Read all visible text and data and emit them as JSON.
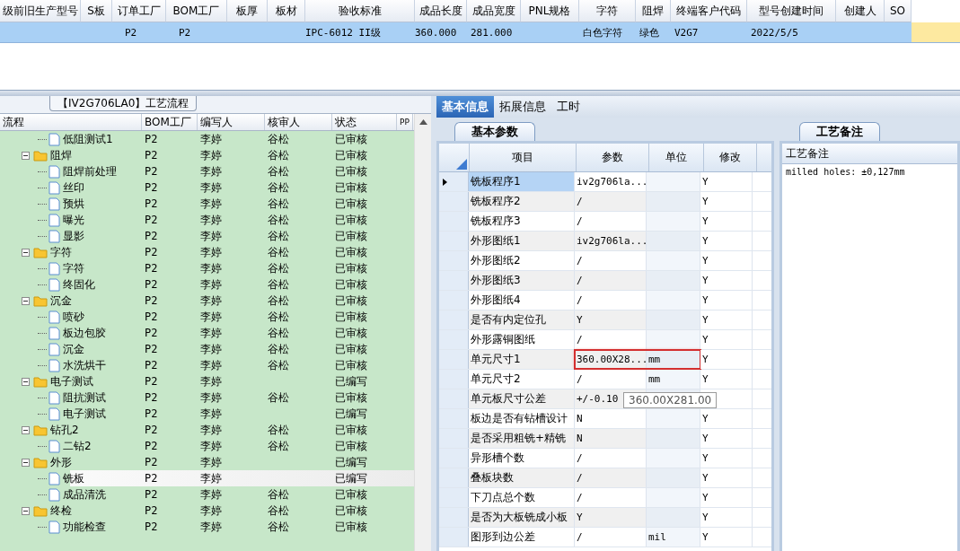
{
  "top_grid": {
    "columns": [
      "级前旧生产型号",
      "S板",
      "订单工厂",
      "BOM工厂",
      "板厚",
      "板材",
      "验收标准",
      "成品长度",
      "成品宽度",
      "PNL规格",
      "字符",
      "阻焊",
      "终端客户代码",
      "型号创建时间",
      "创建人",
      "SO"
    ],
    "rows": [
      {
        "selected": true,
        "cells": [
          null,
          null,
          "P2",
          "P2",
          null,
          null,
          "IPC-6012 II级",
          "360.000",
          "281.000",
          null,
          "白色字符",
          "绿色",
          "V2G7",
          "2022/5/5",
          null,
          null
        ]
      }
    ]
  },
  "process_panel": {
    "title": "【IV2G706LA0】工艺流程",
    "columns": [
      "流程",
      "BOM工厂",
      "编写人",
      "核审人",
      "状态",
      "PP"
    ],
    "leading_items": [
      {
        "label": "低阻测试1",
        "bom": "P2",
        "writer": "李婷",
        "reviewer": "谷松",
        "status": "已审核",
        "selected": false
      }
    ],
    "folders": [
      {
        "label": "阻焊",
        "expanded": true,
        "bom": "P2",
        "writer": "李婷",
        "reviewer": "谷松",
        "status": "已审核",
        "selected": false,
        "children": [
          {
            "label": "阻焊前处理",
            "bom": "P2",
            "writer": "李婷",
            "reviewer": "谷松",
            "status": "已审核",
            "selected": false
          },
          {
            "label": "丝印",
            "bom": "P2",
            "writer": "李婷",
            "reviewer": "谷松",
            "status": "已审核",
            "selected": false
          },
          {
            "label": "预烘",
            "bom": "P2",
            "writer": "李婷",
            "reviewer": "谷松",
            "status": "已审核",
            "selected": false
          },
          {
            "label": "曝光",
            "bom": "P2",
            "writer": "李婷",
            "reviewer": "谷松",
            "status": "已审核",
            "selected": false
          },
          {
            "label": "显影",
            "bom": "P2",
            "writer": "李婷",
            "reviewer": "谷松",
            "status": "已审核",
            "selected": false
          }
        ]
      },
      {
        "label": "字符",
        "expanded": true,
        "bom": "P2",
        "writer": "李婷",
        "reviewer": "谷松",
        "status": "已审核",
        "selected": false,
        "children": [
          {
            "label": "字符",
            "bom": "P2",
            "writer": "李婷",
            "reviewer": "谷松",
            "status": "已审核",
            "selected": false
          },
          {
            "label": "终固化",
            "bom": "P2",
            "writer": "李婷",
            "reviewer": "谷松",
            "status": "已审核",
            "selected": false
          }
        ]
      },
      {
        "label": "沉金",
        "expanded": true,
        "bom": "P2",
        "writer": "李婷",
        "reviewer": "谷松",
        "status": "已审核",
        "selected": false,
        "children": [
          {
            "label": "喷砂",
            "bom": "P2",
            "writer": "李婷",
            "reviewer": "谷松",
            "status": "已审核",
            "selected": false
          },
          {
            "label": "板边包胶",
            "bom": "P2",
            "writer": "李婷",
            "reviewer": "谷松",
            "status": "已审核",
            "selected": false
          },
          {
            "label": "沉金",
            "bom": "P2",
            "writer": "李婷",
            "reviewer": "谷松",
            "status": "已审核",
            "selected": false
          },
          {
            "label": "水洗烘干",
            "bom": "P2",
            "writer": "李婷",
            "reviewer": "谷松",
            "status": "已审核",
            "selected": false
          }
        ]
      },
      {
        "label": "电子测试",
        "expanded": true,
        "bom": "P2",
        "writer": "李婷",
        "status": "已编写",
        "selected": false,
        "children": [
          {
            "label": "阻抗测试",
            "bom": "P2",
            "writer": "李婷",
            "reviewer": "谷松",
            "status": "已审核",
            "selected": false
          },
          {
            "label": "电子测试",
            "bom": "P2",
            "writer": "李婷",
            "status": "已编写",
            "selected": false
          }
        ]
      },
      {
        "label": "钻孔2",
        "expanded": true,
        "bom": "P2",
        "writer": "李婷",
        "reviewer": "谷松",
        "status": "已审核",
        "selected": false,
        "children": [
          {
            "label": "二钻2",
            "bom": "P2",
            "writer": "李婷",
            "reviewer": "谷松",
            "status": "已审核",
            "selected": false
          }
        ]
      },
      {
        "label": "外形",
        "expanded": true,
        "bom": "P2",
        "writer": "李婷",
        "status": "已编写",
        "selected": false,
        "children": [
          {
            "label": "铣板",
            "bom": "P2",
            "writer": "李婷",
            "status": "已编写",
            "selected": true
          },
          {
            "label": "成品清洗",
            "bom": "P2",
            "writer": "李婷",
            "reviewer": "谷松",
            "status": "已审核",
            "selected": false
          }
        ]
      },
      {
        "label": "终检",
        "expanded": true,
        "bom": "P2",
        "writer": "李婷",
        "reviewer": "谷松",
        "status": "已审核",
        "selected": false,
        "children": [
          {
            "label": "功能检查",
            "bom": "P2",
            "writer": "李婷",
            "reviewer": "谷松",
            "status": "已审核",
            "selected": false
          }
        ]
      }
    ]
  },
  "info_tabs": [
    {
      "label": "基本信息",
      "selected": true
    },
    {
      "label": "拓展信息",
      "selected": false
    },
    {
      "label": "工时",
      "selected": false
    }
  ],
  "params_panel": {
    "tab": "基本参数",
    "columns": [
      "项目",
      "参数",
      "单位",
      "修改"
    ],
    "rows": [
      {
        "item": "铣板程序1",
        "value": "iv2g706la...",
        "modify": "Y",
        "current": true,
        "highlighted": false
      },
      {
        "item": "铣板程序2",
        "value": "/",
        "modify": "Y",
        "current": false,
        "highlighted": false
      },
      {
        "item": "铣板程序3",
        "value": "/",
        "modify": "Y",
        "current": false,
        "highlighted": false
      },
      {
        "item": "外形图纸1",
        "value": "iv2g706la...",
        "modify": "Y",
        "current": false,
        "highlighted": false
      },
      {
        "item": "外形图纸2",
        "value": "/",
        "modify": "Y",
        "current": false,
        "highlighted": false
      },
      {
        "item": "外形图纸3",
        "value": "/",
        "modify": "Y",
        "current": false,
        "highlighted": false
      },
      {
        "item": "外形图纸4",
        "value": "/",
        "modify": "Y",
        "current": false,
        "highlighted": false
      },
      {
        "item": "是否有内定位孔",
        "value": "Y",
        "modify": "Y",
        "current": false,
        "highlighted": false
      },
      {
        "item": "外形露铜图纸",
        "value": "/",
        "modify": "Y",
        "current": false,
        "highlighted": false
      },
      {
        "item": "单元尺寸1",
        "value": "360.00X28...",
        "unit": "mm",
        "modify": "Y",
        "current": false,
        "highlighted": true
      },
      {
        "item": "单元尺寸2",
        "value": "/",
        "unit": "mm",
        "modify": "Y",
        "current": false,
        "highlighted": false
      },
      {
        "item": "单元板尺寸公差",
        "value": "+/-0.10",
        "current": false,
        "highlighted": false
      },
      {
        "item": "板边是否有钻槽设计",
        "value": "N",
        "modify": "Y",
        "current": false,
        "highlighted": false
      },
      {
        "item": "是否采用粗铣+精铣",
        "value": "N",
        "modify": "Y",
        "current": false,
        "highlighted": false
      },
      {
        "item": "异形槽个数",
        "value": "/",
        "modify": "Y",
        "current": false,
        "highlighted": false
      },
      {
        "item": "叠板块数",
        "value": "/",
        "modify": "Y",
        "current": false,
        "highlighted": false
      },
      {
        "item": "下刀点总个数",
        "value": "/",
        "modify": "Y",
        "current": false,
        "highlighted": false
      },
      {
        "item": "是否为大板铣成小板",
        "value": "Y",
        "modify": "Y",
        "current": false,
        "highlighted": false
      },
      {
        "item": "图形到边公差",
        "value": "/",
        "unit": "mil",
        "modify": "Y",
        "current": false,
        "highlighted": false
      }
    ],
    "tooltip": "360.00X281.00"
  },
  "notes_panel": {
    "tab": "工艺备注",
    "header": "工艺备注",
    "text": "milled holes: ±0,127mm"
  }
}
